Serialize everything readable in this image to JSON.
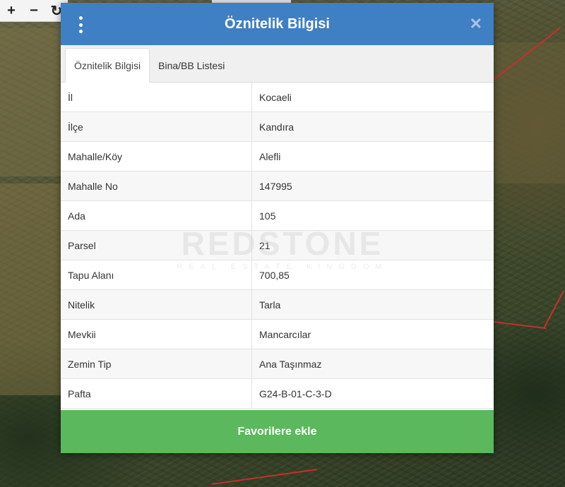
{
  "map": {
    "toolbar": [
      {
        "name": "zoom-in",
        "symbol": "+"
      },
      {
        "name": "zoom-out",
        "symbol": "−"
      },
      {
        "name": "refresh",
        "symbol": "↻"
      }
    ]
  },
  "modal": {
    "title": "Öznitelik Bilgisi",
    "close_symbol": "✕",
    "tabs": [
      {
        "label": "Öznitelik Bilgisi",
        "active": true
      },
      {
        "label": "Bina/BB Listesi",
        "active": false
      }
    ],
    "rows": [
      {
        "key": "İl",
        "value": "Kocaeli"
      },
      {
        "key": "İlçe",
        "value": "Kandıra"
      },
      {
        "key": "Mahalle/Köy",
        "value": "Alefli"
      },
      {
        "key": "Mahalle No",
        "value": "147995"
      },
      {
        "key": "Ada",
        "value": "105"
      },
      {
        "key": "Parsel",
        "value": "21"
      },
      {
        "key": "Tapu Alanı",
        "value": "700,85"
      },
      {
        "key": "Nitelik",
        "value": "Tarla"
      },
      {
        "key": "Mevkii",
        "value": "Mancarcılar"
      },
      {
        "key": "Zemin Tip",
        "value": "Ana Taşınmaz"
      },
      {
        "key": "Pafta",
        "value": "G24-B-01-C-3-D"
      }
    ],
    "favorite_button": "Favorilere ekle"
  },
  "watermark": {
    "main": "REDSTONE",
    "sub": "REAL ESTATE KINGDOM"
  },
  "colors": {
    "header": "#3f7fc4",
    "favorite_button": "#5cb85c",
    "parcel_line": "#c4312c"
  }
}
